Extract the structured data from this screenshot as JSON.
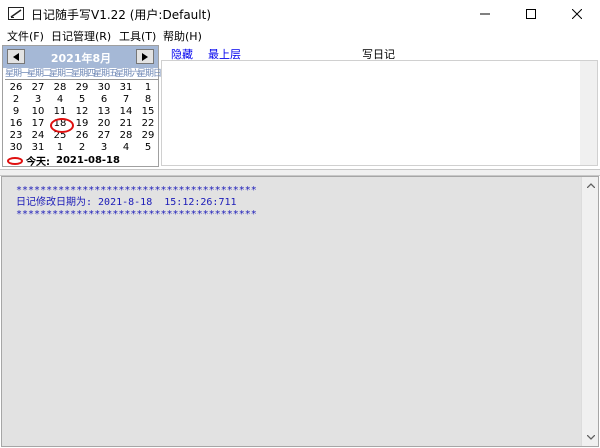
{
  "window": {
    "title": "日记随手写V1.22 (用户:Default)",
    "icons": [
      "app-icon",
      "minimize-icon",
      "maximize-icon",
      "close-icon"
    ]
  },
  "menu": {
    "items": [
      {
        "label": "文件(F)"
      },
      {
        "label": "日记管理(R)"
      },
      {
        "label": "工具(T)"
      },
      {
        "label": "帮助(H)"
      }
    ]
  },
  "calendar": {
    "month_label": "2021年8月",
    "weekdays": [
      "星期一",
      "星期二",
      "星期三",
      "星期四",
      "星期五",
      "星期六",
      "星期日"
    ],
    "days": [
      "26",
      "27",
      "28",
      "29",
      "30",
      "31",
      "1",
      "2",
      "3",
      "4",
      "5",
      "6",
      "7",
      "8",
      "9",
      "10",
      "11",
      "12",
      "13",
      "14",
      "15",
      "16",
      "17",
      "18",
      "19",
      "20",
      "21",
      "22",
      "23",
      "24",
      "25",
      "26",
      "27",
      "28",
      "29",
      "30",
      "31",
      "1",
      "2",
      "3",
      "4",
      "5"
    ],
    "selected_day_index": 23,
    "today_label": "今天:",
    "today_date": "2021-08-18",
    "accent_color": "#a5b8d6",
    "highlight_color": "#e01010"
  },
  "toolbar": {
    "hide_label": "隐藏",
    "top_label": "最上层",
    "write_label": "写日记",
    "link_color": "#0000ee"
  },
  "editor": {
    "line1": "****************************************",
    "line2": "日记修改日期为: 2021-8-18  15:12:26:711",
    "line3": "****************************************",
    "text_color": "#1a1ab8"
  }
}
